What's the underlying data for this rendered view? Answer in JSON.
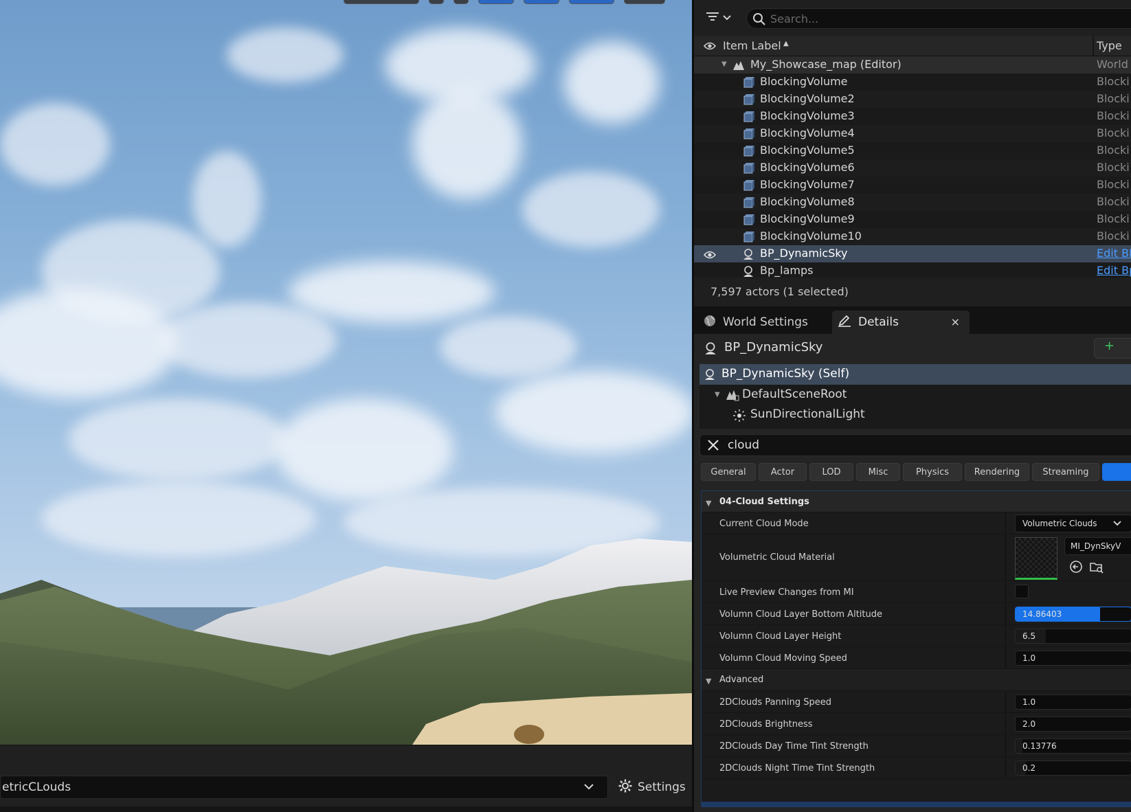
{
  "viewport": {
    "bottom_combo_text": "etricCLouds",
    "settings_label": "Settings",
    "icons": {
      "chevron": "chevron-down-icon",
      "settings": "gear-icon"
    }
  },
  "outliner": {
    "search_placeholder": "Search...",
    "columns": {
      "label": "Item Label",
      "type": "Type"
    },
    "rows": [
      {
        "label": "My_Showcase_map (Editor)",
        "type": "World",
        "kind": "world"
      },
      {
        "label": "BlockingVolume",
        "type": "Blocki",
        "kind": "volume"
      },
      {
        "label": "BlockingVolume2",
        "type": "Blocki",
        "kind": "volume"
      },
      {
        "label": "BlockingVolume3",
        "type": "Blocki",
        "kind": "volume"
      },
      {
        "label": "BlockingVolume4",
        "type": "Blocki",
        "kind": "volume"
      },
      {
        "label": "BlockingVolume5",
        "type": "Blocki",
        "kind": "volume"
      },
      {
        "label": "BlockingVolume6",
        "type": "Blocki",
        "kind": "volume"
      },
      {
        "label": "BlockingVolume7",
        "type": "Blocki",
        "kind": "volume"
      },
      {
        "label": "BlockingVolume8",
        "type": "Blocki",
        "kind": "volume"
      },
      {
        "label": "BlockingVolume9",
        "type": "Blocki",
        "kind": "volume"
      },
      {
        "label": "BlockingVolume10",
        "type": "Blocki",
        "kind": "volume"
      },
      {
        "label": "BP_DynamicSky",
        "type": "Edit BI",
        "kind": "blueprint",
        "selected": true
      },
      {
        "label": "Bp_lamps",
        "type": "Edit Bp",
        "kind": "blueprint"
      }
    ],
    "status": "7,597 actors (1 selected)"
  },
  "tabs": {
    "world_settings": "World Settings",
    "details": "Details",
    "close": "×"
  },
  "details": {
    "actor_name": "BP_DynamicSky",
    "add_label": "+",
    "components": [
      {
        "label": "BP_DynamicSky (Self)"
      },
      {
        "label": "DefaultSceneRoot"
      },
      {
        "label": "SunDirectionalLight"
      }
    ],
    "filter_value": "cloud",
    "categories": [
      "General",
      "Actor",
      "LOD",
      "Misc",
      "Physics",
      "Rendering",
      "Streaming"
    ],
    "section_cloud": "04-Cloud Settings",
    "properties": {
      "current_cloud_mode": {
        "name": "Current Cloud Mode",
        "value": "Volumetric Clouds"
      },
      "volumetric_cloud_material": {
        "name": "Volumetric Cloud Material",
        "value": "MI_DynSkyV"
      },
      "live_preview": {
        "name": "Live Preview Changes from MI",
        "checked": false
      },
      "bottom_altitude": {
        "name": "Volumn Cloud Layer Bottom Altitude",
        "value": "14.86403",
        "fill": 0.73
      },
      "layer_height": {
        "name": "Volumn Cloud Layer Height",
        "value": "6.5",
        "fill": 0.26
      },
      "moving_speed": {
        "name": "Volumn Cloud Moving Speed",
        "value": "1.0",
        "fill": 0.0
      }
    },
    "section_advanced": "Advanced",
    "advanced": {
      "panning_speed": {
        "name": "2DClouds Panning Speed",
        "value": "1.0",
        "fill": 0.0
      },
      "brightness": {
        "name": "2DClouds Brightness",
        "value": "2.0",
        "fill": 0.0
      },
      "day_tint": {
        "name": "2DClouds Day Time Tint Strength",
        "value": "0.13776",
        "fill": 0.06
      },
      "night_tint": {
        "name": "2DClouds Night Time Tint Strength",
        "value": "0.2",
        "fill": 0.09
      }
    }
  },
  "colors": {
    "accent": "#1a73e8",
    "selection": "#3d4a5c",
    "link": "#4a9cff",
    "add_green": "#3cc45c"
  }
}
